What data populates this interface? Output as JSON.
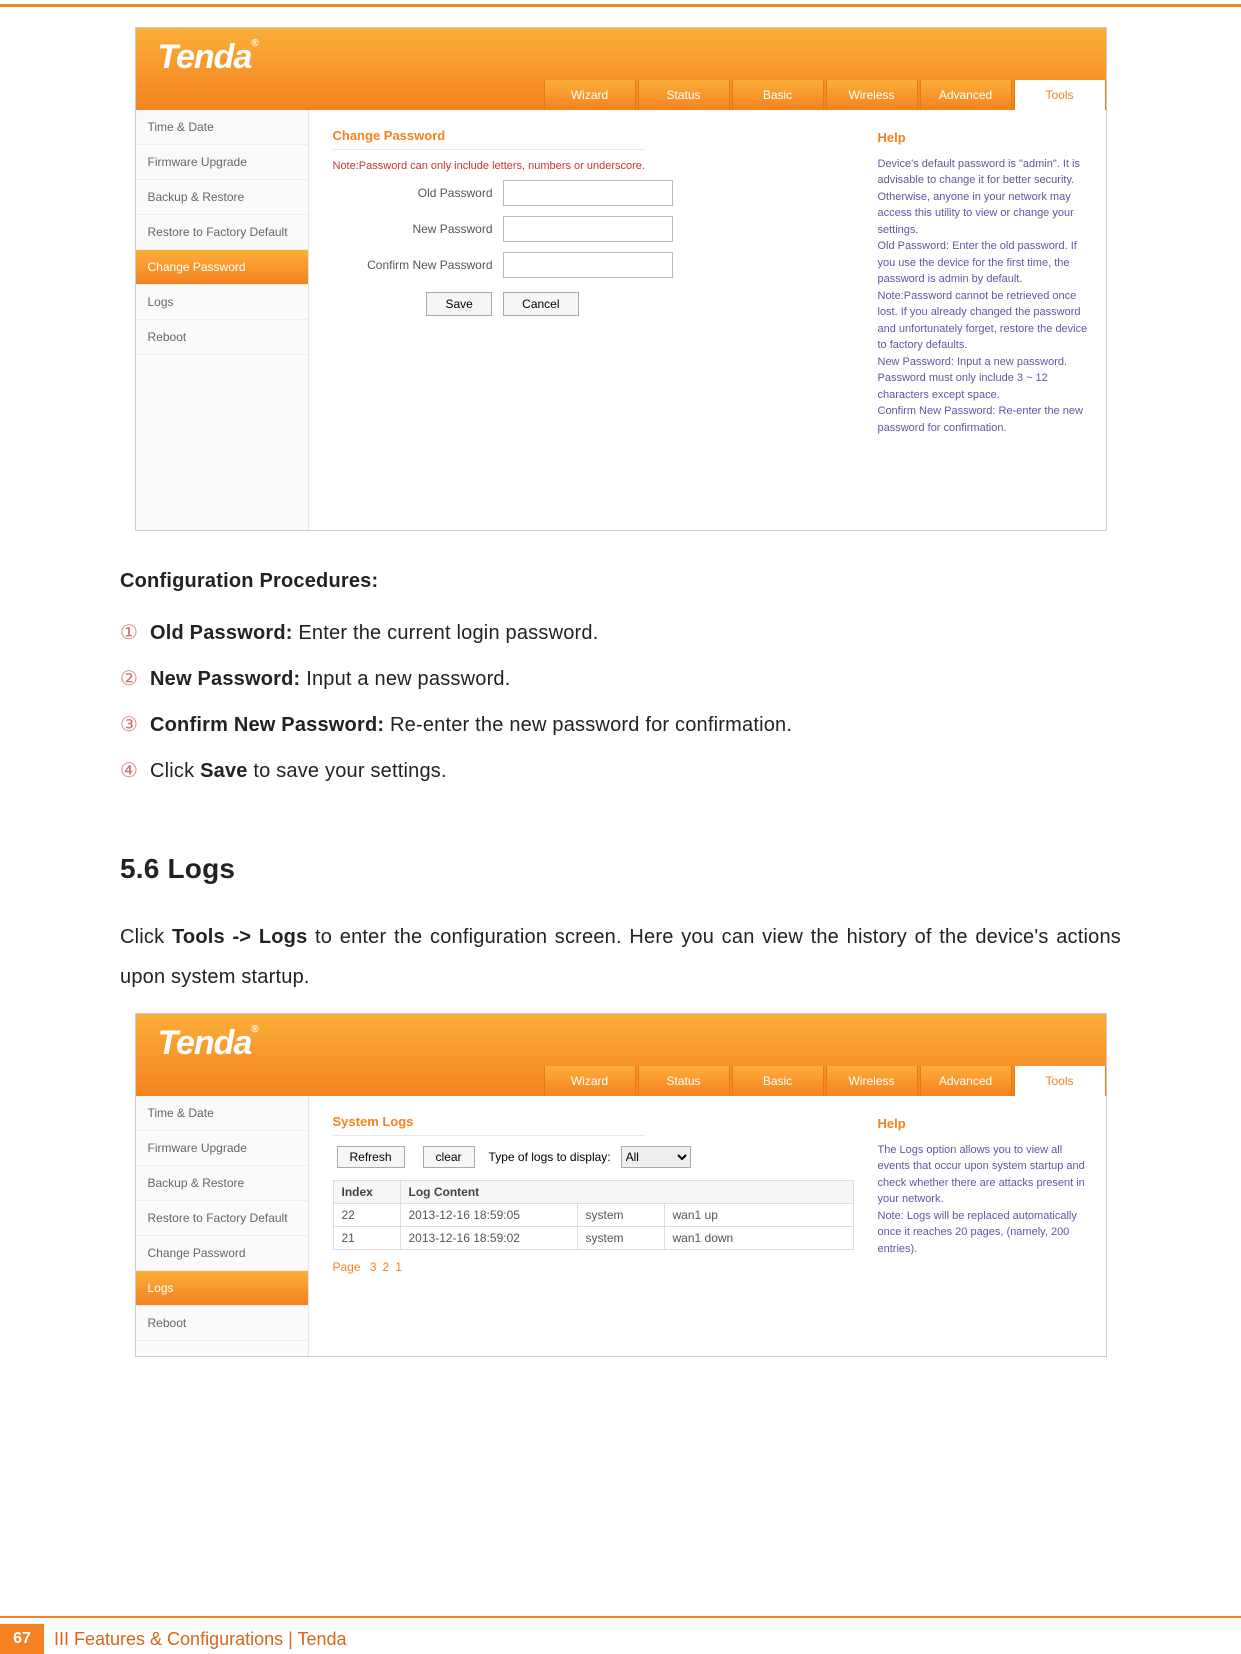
{
  "screenshot1": {
    "logo": "Tenda",
    "tabs": [
      "Wizard",
      "Status",
      "Basic",
      "Wireless",
      "Advanced",
      "Tools"
    ],
    "active_tab_index": 5,
    "sidebar": [
      "Time & Date",
      "Firmware Upgrade",
      "Backup & Restore",
      "Restore to Factory Default",
      "Change Password",
      "Logs",
      "Reboot"
    ],
    "active_side_index": 4,
    "panel_title": "Change Password",
    "note": "Note:Password can only include letters, numbers or underscore.",
    "labels": {
      "old": "Old Password",
      "new": "New Password",
      "confirm": "Confirm New Password"
    },
    "buttons": {
      "save": "Save",
      "cancel": "Cancel"
    },
    "help_title": "Help",
    "help_text": "Device's default password is \"admin\". It is advisable to change it for better security. Otherwise, anyone in your network may access this utility to view or change your settings.\nOld Password: Enter the old password. If you use the device for the first time, the password is admin by default. Note:Password cannot be retrieved once lost. If you already changed the password and unfortunately forget, restore the device to factory defaults.\nNew Password: Input a new password. Password must only include 3 ~ 12 characters except space.\nConfirm New Password: Re-enter the new password for confirmation."
  },
  "doc": {
    "cfg_heading": "Configuration Procedures:",
    "steps": [
      {
        "num": "①",
        "bold": "Old Password:",
        "rest": " Enter the current login password."
      },
      {
        "num": "②",
        "bold": "New Password:",
        "rest": " Input a new password."
      },
      {
        "num": "③",
        "bold": "Confirm New Password:",
        "rest": " Re-enter the new password for confirmation."
      },
      {
        "num": "④",
        "bold": "",
        "rest": "Click ",
        "bold2": "Save",
        "rest2": " to save your settings."
      }
    ],
    "section_title": "5.6 Logs",
    "para_a": "Click ",
    "para_bold": "Tools -> Logs",
    "para_b": " to enter the configuration screen. Here you can view the history of the device's actions upon system startup."
  },
  "screenshot2": {
    "panel_title": "System Logs",
    "refresh": "Refresh",
    "clear": "clear",
    "type_label": "Type of logs to display:",
    "type_value": "All",
    "active_side_index": 5,
    "table_headers": [
      "Index",
      "Log Content",
      "",
      ""
    ],
    "rows": [
      {
        "idx": "22",
        "time": "2013-12-16 18:59:05",
        "sys": "system",
        "msg": "wan1 up"
      },
      {
        "idx": "21",
        "time": "2013-12-16 18:59:02",
        "sys": "system",
        "msg": "wan1 down"
      }
    ],
    "pager_label": "Page ",
    "pages": [
      "3",
      "2",
      "1"
    ],
    "help_title": "Help",
    "help_text": "The Logs option allows you to view all events that occur upon system startup and check whether there are attacks present in your network.\nNote: Logs will be replaced automatically once it reaches 20 pages, (namely, 200 entries)."
  },
  "footer": {
    "page_num": "67",
    "text": "III Features & Configurations | Tenda"
  }
}
